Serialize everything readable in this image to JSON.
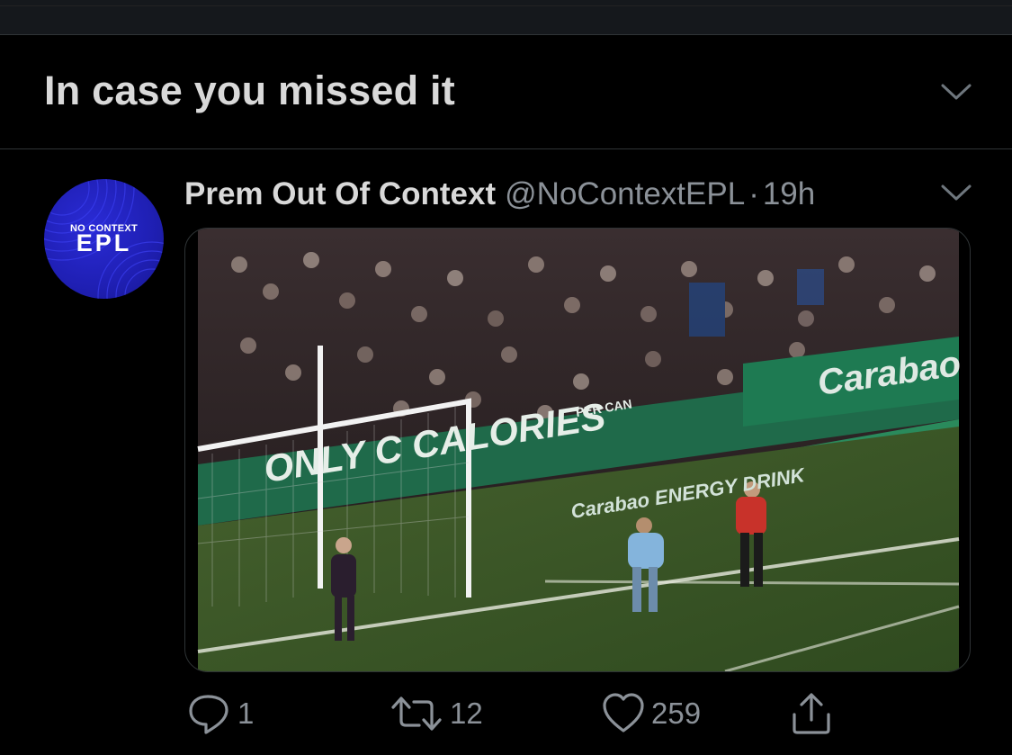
{
  "section": {
    "title": "In case you missed it"
  },
  "tweet": {
    "author_name": "Prem Out Of Context",
    "handle": "@NoContextEPL",
    "separator": "·",
    "time": "19h",
    "avatar": {
      "line1": "NO CONTEXT",
      "line2": "EPL"
    },
    "media": {
      "ad_board_1": "ONLY C   CALORIES",
      "ad_board_1_small": "PER CAN",
      "ad_board_2": "Carabao",
      "ad_board_3": "Carabao ENERGY DRINK"
    },
    "actions": {
      "replies": "1",
      "retweets": "12",
      "likes": "259"
    }
  },
  "colors": {
    "background": "#000000",
    "text_primary": "#d9d9d9",
    "text_secondary": "#8b9198",
    "divider": "#2f3336",
    "avatar_blue": "#2022c4"
  },
  "icons": {
    "header_menu": "chevron-down-icon",
    "tweet_menu": "chevron-down-icon",
    "reply": "reply-icon",
    "retweet": "retweet-icon",
    "like": "heart-icon",
    "share": "share-icon"
  }
}
